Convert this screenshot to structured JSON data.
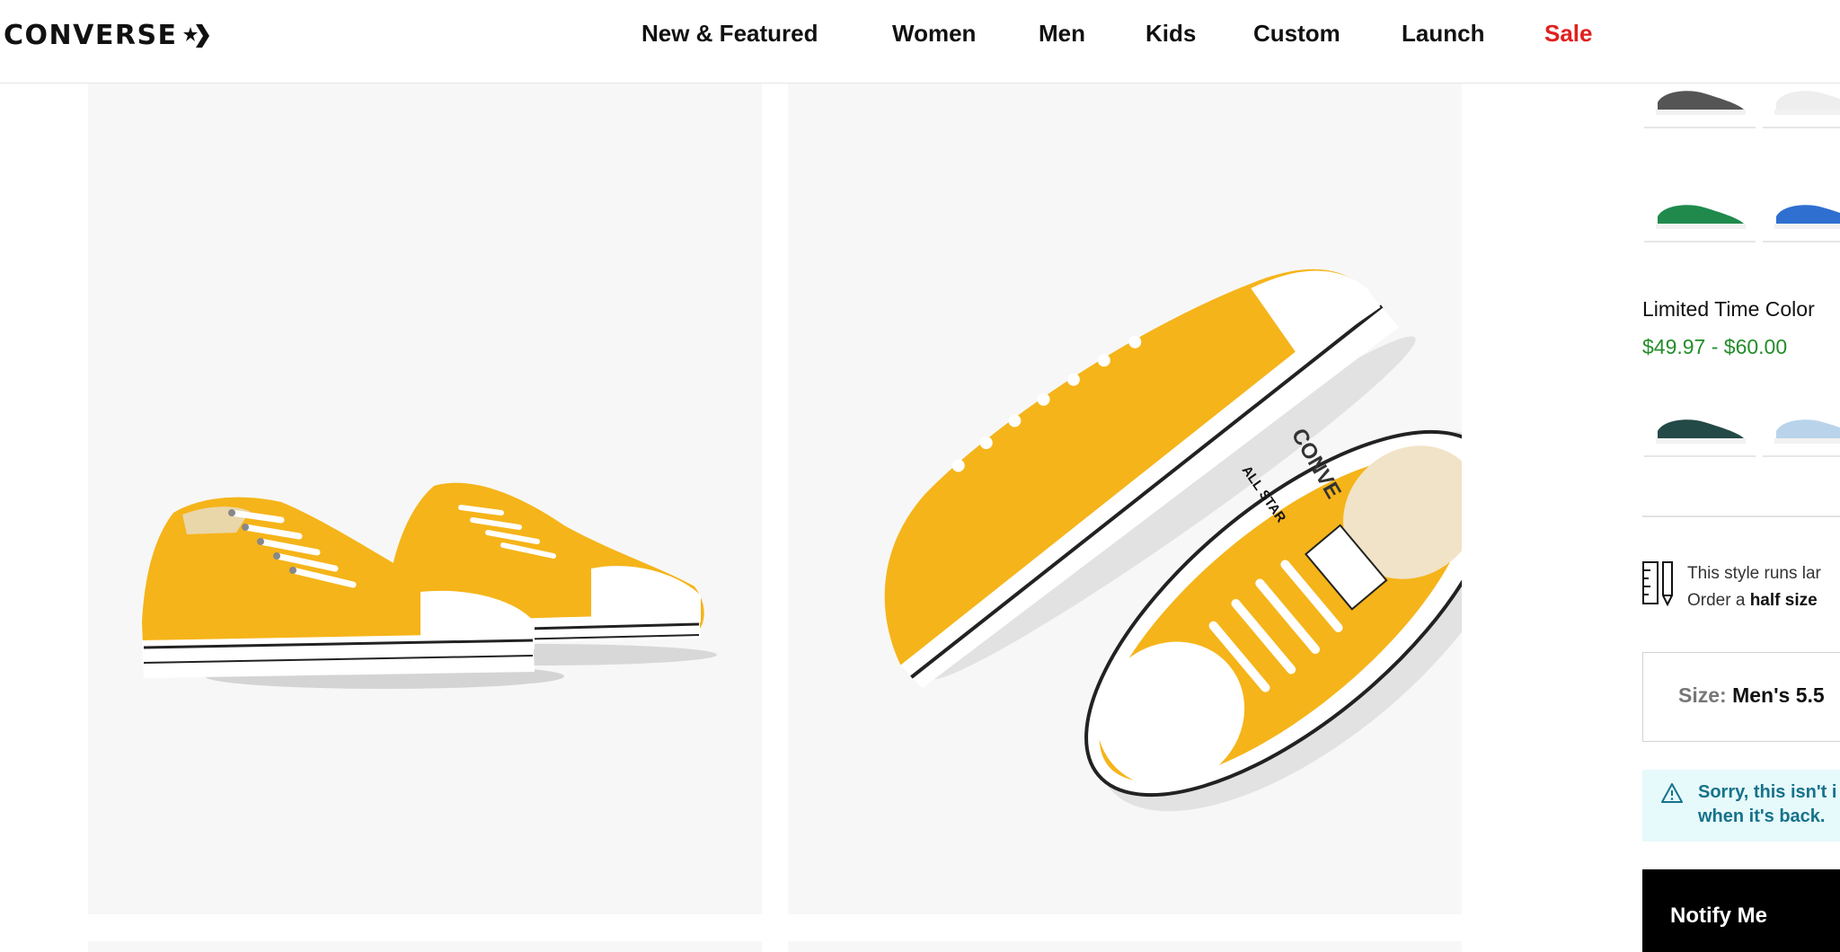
{
  "brand": {
    "logo_text": "CONVERSE"
  },
  "nav": {
    "items": [
      {
        "label": "New & Featured"
      },
      {
        "label": "Women"
      },
      {
        "label": "Men"
      },
      {
        "label": "Kids"
      },
      {
        "label": "Custom"
      },
      {
        "label": "Launch"
      },
      {
        "label": "Sale"
      }
    ],
    "sale_color": "#e0201f"
  },
  "gallery": {
    "product_color": "#f5b419",
    "images": [
      {
        "alt": "Yellow low-top sneakers pair, angled view"
      },
      {
        "alt": "Yellow low-top sneakers, top-down view"
      }
    ],
    "insole_text": "CONVE",
    "tongue_label": "ALL STAR"
  },
  "colorways": {
    "top_swatches": [
      {
        "color": "#555555"
      },
      {
        "color": "#eeeeee"
      },
      {
        "color": "#1f8a4c"
      },
      {
        "color": "#2f6fd0"
      }
    ],
    "promo_title": "Limited Time Color",
    "promo_price": "$49.97 - $60.00",
    "promo_swatches": [
      {
        "color": "#234a47"
      },
      {
        "color": "#b9d4ea"
      }
    ]
  },
  "fit_note": {
    "line1": "This style runs lar",
    "line2_prefix": "Order a ",
    "line2_bold": "half size "
  },
  "size": {
    "label": "Size:",
    "value": "Men's 5.5"
  },
  "alert": {
    "line1": "Sorry, this isn't i",
    "line2": "when it's back."
  },
  "notify_button": {
    "label": "Notify Me"
  }
}
